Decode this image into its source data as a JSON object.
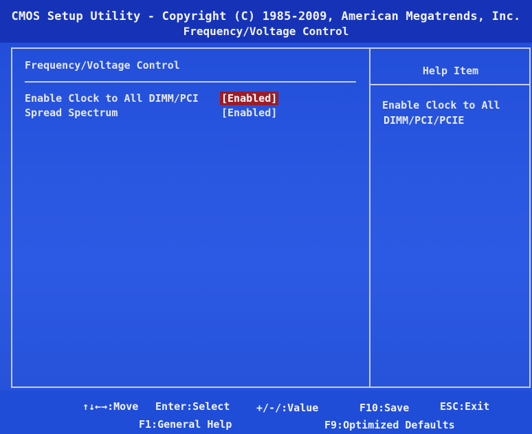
{
  "title": {
    "line1": "CMOS Setup Utility - Copyright (C) 1985-2009, American Megatrends, Inc.",
    "line2": "Frequency/Voltage Control"
  },
  "main": {
    "section_title": "Frequency/Voltage Control",
    "settings": [
      {
        "label": "Enable Clock to All DIMM/PCI",
        "value": "[Enabled]",
        "selected": true
      },
      {
        "label": "Spread Spectrum",
        "value": "[Enabled]",
        "selected": false
      }
    ]
  },
  "help": {
    "title": "Help Item",
    "lines": [
      "Enable Clock to All",
      "DIMM/PCI/PCIE"
    ]
  },
  "footer": {
    "move": "↑↓←→:Move",
    "select": "Enter:Select",
    "value": "+/-/:Value",
    "save": "F10:Save",
    "exit": "ESC:Exit",
    "help": "F1:General Help",
    "defaults": "F9:Optimized Defaults"
  },
  "colors": {
    "background": "#2a57e0",
    "highlight": "#9c1d28",
    "border": "#c9cde8"
  }
}
